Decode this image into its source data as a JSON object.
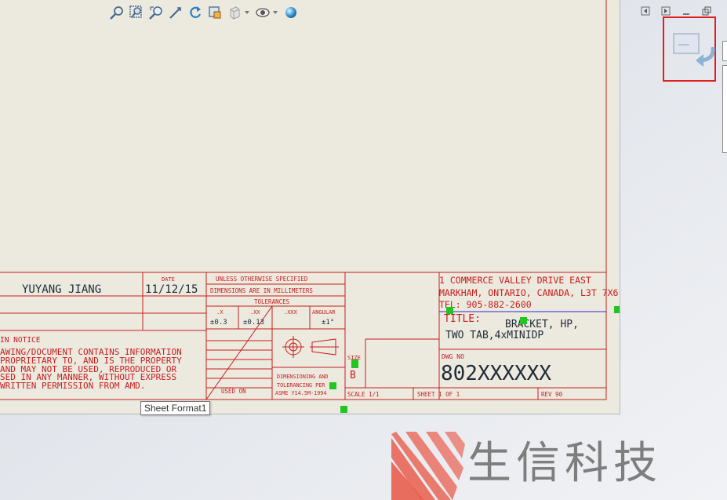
{
  "toolbar": {
    "icons": [
      "zoom-to-fit-icon",
      "zoom-area-icon",
      "zoom-in-out-icon",
      "select-icon",
      "rotate-icon",
      "view-orientation-icon",
      "display-style-icon",
      "hide-show-icon",
      "appearance-icon"
    ]
  },
  "title_block": {
    "drawn_by": "YUYANG JIANG",
    "date_label": "DATE",
    "date": "11/12/15",
    "notice_header": "IN NOTICE",
    "notice_lines": [
      "AWING/DOCUMENT CONTAINS INFORMATION",
      " PROPRIETARY TO, AND IS THE PROPERTY",
      "AND MAY NOT BE USED, REPRODUCED OR",
      "SED IN ANY MANNER, WITHOUT EXPRESS",
      " WRITTEN PERMISSION FROM AMD."
    ],
    "unless_specified": "UNLESS OTHERWISE SPECIFIED",
    "dimensions_mm": "DIMENSIONS ARE IN MILLIMETERS",
    "tolerances": "TOLERANCES",
    "tol_headers": [
      ".X",
      ".XX",
      ".XXX",
      "ANGULAR"
    ],
    "tol_values": [
      "±0.3",
      "±0.13",
      "",
      "±1°"
    ],
    "used_on": "USED ON",
    "dim_tol_lines": [
      "DIMENSIONING AND",
      "TOLERANCING PER",
      "ASME Y14.5M-1994"
    ],
    "size_label": "SIZE",
    "size_value": "B",
    "address_lines": [
      "1 COMMERCE VALLEY DRIVE EAST",
      "MARKHAM, ONTARIO, CANADA, L3T 7X6",
      "TEL: 905-882-2600"
    ],
    "title_label": "TITLE:",
    "title_line1": "BRACKET, HP,",
    "title_line2": "TWO TAB,4xMINIDP",
    "dwg_no_label": "DWG NO",
    "dwg_no": "802XXXXXX",
    "scale": "SCALE 1/1",
    "sheet": "SHEET 1 OF 1",
    "rev": "REV 90"
  },
  "tooltip": "Sheet Format1",
  "watermark": {
    "text": "生信科技"
  },
  "colors": {
    "drawing_red": "#c81e1e",
    "sheet_bg": "#ece9df",
    "highlight": "#e02020",
    "handle_green": "#22c522"
  }
}
